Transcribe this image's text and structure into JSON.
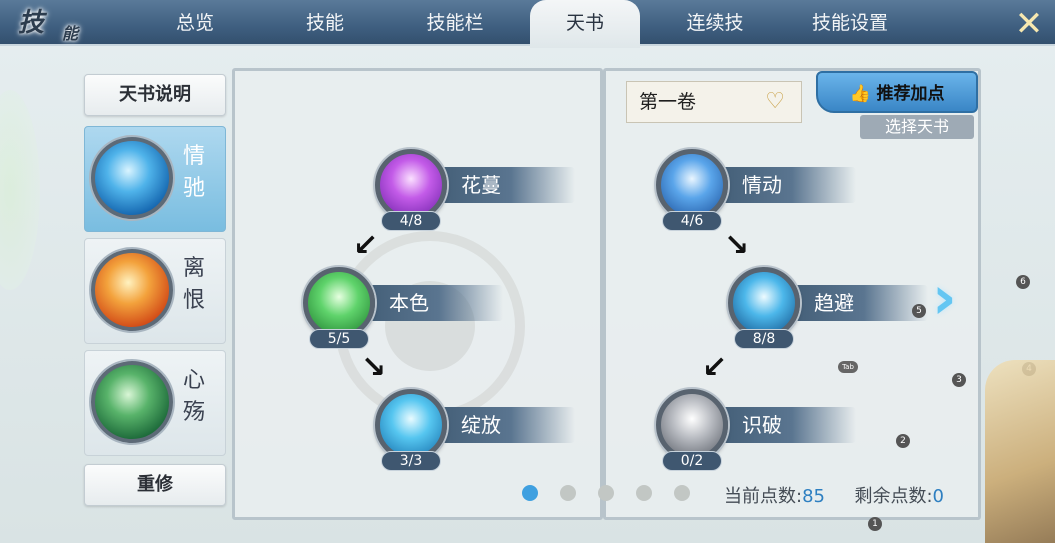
{
  "header": {
    "logo_text": "技",
    "logo_text_small": "能",
    "tabs": [
      {
        "label": "总览"
      },
      {
        "label": "技能"
      },
      {
        "label": "技能栏"
      },
      {
        "label": "天书"
      },
      {
        "label": "连续技"
      },
      {
        "label": "技能设置"
      }
    ],
    "active_tab": "天书",
    "close_glyph": "✕"
  },
  "sidebar": {
    "explain_label": "天书说明",
    "books": [
      {
        "name_line1": "情",
        "name_line2": "驰",
        "active": true
      },
      {
        "name_line1": "离",
        "name_line2": "恨",
        "active": false
      },
      {
        "name_line1": "心",
        "name_line2": "殇",
        "active": false
      }
    ],
    "relearn_label": "重修"
  },
  "left_tree": {
    "skills": [
      {
        "name": "花蔓",
        "count": "4/8"
      },
      {
        "name": "本色",
        "count": "5/5"
      },
      {
        "name": "绽放",
        "count": "3/3"
      }
    ]
  },
  "right_tree": {
    "volume": "第一卷",
    "recommend_label": "推荐加点",
    "choose_label": "选择天书",
    "skills": [
      {
        "name": "情动",
        "count": "4/6"
      },
      {
        "name": "趋避",
        "count": "8/8"
      },
      {
        "name": "识破",
        "count": "0/2"
      }
    ]
  },
  "pager": {
    "pages": 5,
    "current": 1
  },
  "points": {
    "current_label": "当前点数:",
    "current_value": "85",
    "remaining_label": "剩余点数:",
    "remaining_value": "0"
  },
  "badges": [
    "1",
    "2",
    "3",
    "4",
    "5",
    "6"
  ],
  "tab_key": "Tab",
  "colors": {
    "topbar": "#3f5f80",
    "accent_blue": "#3fa0e0",
    "points_blue": "#2d7fc1"
  }
}
